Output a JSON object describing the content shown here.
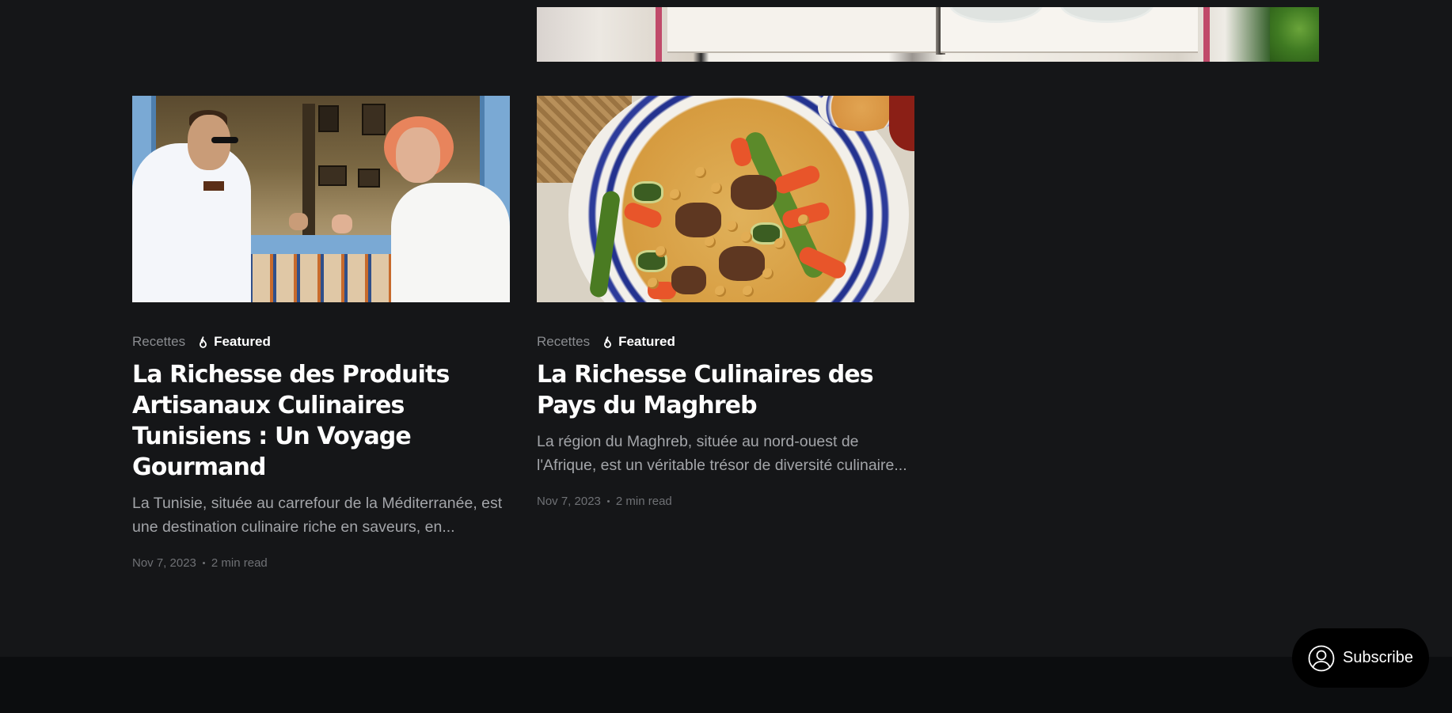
{
  "posts": [
    {
      "category": "Recettes",
      "featured_label": "Featured",
      "title": "La Richesse des Produits Artisanaux Culinaires Tunisiens : Un Voyage Gourmand",
      "excerpt": "La Tunisie, située au carrefour de la Méditerranée, est une destination culinaire riche en saveurs, en...",
      "date": "Nov 7, 2023",
      "read_time": "2 min read",
      "image_icon": "cafe-couple-image"
    },
    {
      "category": "Recettes",
      "featured_label": "Featured",
      "title": "La Richesse Culinaires des Pays du Maghreb",
      "excerpt": "La région du Maghreb, située au nord-ouest de l'Afrique, est un véritable trésor de diversité culinaire...",
      "date": "Nov 7, 2023",
      "read_time": "2 min read",
      "image_icon": "couscous-plate-image"
    }
  ],
  "subscribe": {
    "label": "Subscribe",
    "icon": "user-circle-icon"
  },
  "colors": {
    "background": "#151618",
    "footer": "#0c0d0f",
    "muted_text": "#a3a5a9",
    "meta_text": "#6f7175",
    "category_text": "#8a8c90"
  }
}
